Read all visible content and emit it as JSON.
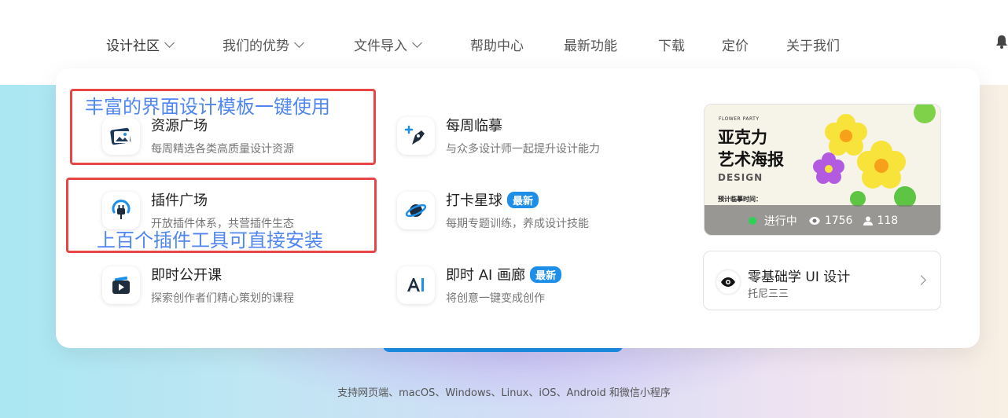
{
  "nav": {
    "items": [
      {
        "label": "设计社区",
        "dropdown": true
      },
      {
        "label": "我们的优势",
        "dropdown": true
      },
      {
        "label": "文件导入",
        "dropdown": true
      },
      {
        "label": "帮助中心"
      },
      {
        "label": "最新功能"
      },
      {
        "label": "下载"
      },
      {
        "label": "定价"
      },
      {
        "label": "关于我们"
      }
    ]
  },
  "menu": {
    "items": [
      {
        "title": "资源广场",
        "desc": "每周精选各类高质量设计资源",
        "icon": "image-gallery-icon"
      },
      {
        "title": "插件广场",
        "desc": "开放插件体系，共营插件生态",
        "icon": "plug-icon"
      },
      {
        "title": "即时公开课",
        "desc": "探索创作者们精心策划的课程",
        "icon": "video-play-icon"
      },
      {
        "title": "每周临摹",
        "desc": "与众多设计师一起提升设计能力",
        "icon": "pen-plus-icon"
      },
      {
        "title": "打卡星球",
        "desc": "每期专题训练，养成设计技能",
        "badge": "最新",
        "icon": "planet-icon"
      },
      {
        "title": "即时 AI 画廊",
        "desc": "将创意一键变成创作",
        "badge": "最新",
        "icon": "ai-icon"
      }
    ]
  },
  "annotations": {
    "a1": "丰富的界面设计模板一键使用",
    "a2": "上百个插件工具可直接安装"
  },
  "poster": {
    "small_text": "FLOWER PARTY",
    "title_line1": "亚克力",
    "title_line2": "艺术海报",
    "sub": "DESIGN",
    "note": "预计临摹时间：",
    "status": "进行中",
    "views": "1756",
    "participants": "118"
  },
  "course": {
    "title": "零基础学 UI 设计",
    "author": "托尼三三"
  },
  "footer": {
    "platforms": "支持网页端、macOS、Windows、Linux、iOS、Android 和微信小程序"
  },
  "colors": {
    "accent": "#1d8fe8",
    "annotation_border": "#e84646",
    "annotation_text": "#4f86f0",
    "live_dot": "#2ed158"
  }
}
